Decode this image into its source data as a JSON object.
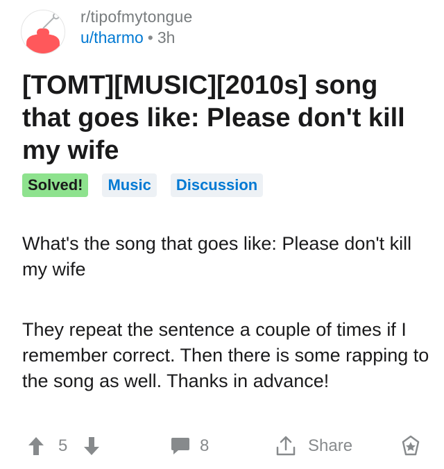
{
  "post": {
    "subreddit": "r/tipofmytongue",
    "author": "u/tharmo",
    "separator": "•",
    "age": "3h",
    "title": "[TOMT][MUSIC][2010s] song that goes like: Please don't kill my wife",
    "flairs": {
      "solved": "Solved!",
      "music": "Music",
      "discussion": "Discussion"
    },
    "body": {
      "paragraph1": "What's the song that goes like: Please don't kill my wife",
      "paragraph2": "They repeat the sentence a couple of times if I remember correct. Then there is some rapping to the song as well. Thanks in advance!"
    }
  },
  "actions": {
    "vote_count": "5",
    "comment_count": "8",
    "share_label": "Share"
  },
  "icons": {
    "upvote": "arrow-up-icon",
    "downvote": "arrow-down-icon",
    "comments": "comment-bubble-icon",
    "share": "share-icon",
    "award": "award-icon",
    "avatar": "subreddit-avatar-icon"
  },
  "colors": {
    "link_blue": "#0079d3",
    "meta_gray": "#787c7e",
    "solved_flair": "#8ee28e",
    "tag_flair": "#edf1f5",
    "avatar_red": "#ff585b"
  }
}
